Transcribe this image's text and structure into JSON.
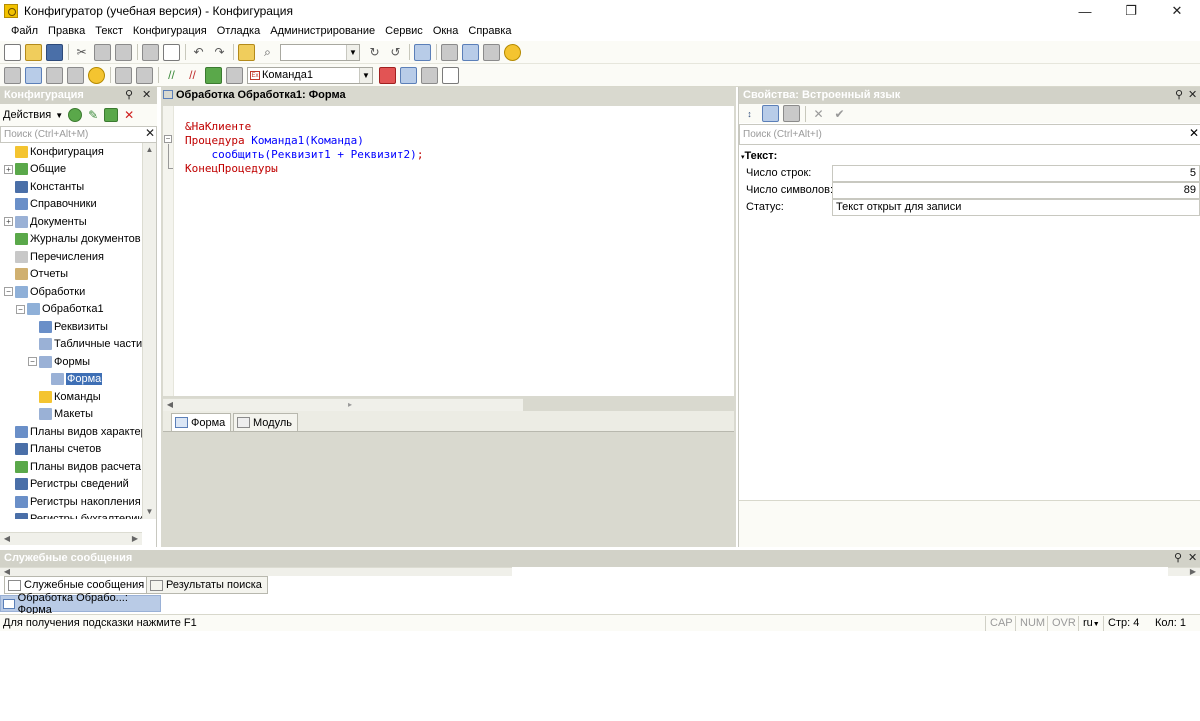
{
  "window": {
    "title": "Конфигуратор (учебная версия) - Конфигурация",
    "minimize": "—",
    "restore": "❐",
    "close": "✕"
  },
  "menu": [
    "Файл",
    "Правка",
    "Текст",
    "Конфигурация",
    "Отладка",
    "Администрирование",
    "Сервис",
    "Окна",
    "Справка"
  ],
  "toolbar": {
    "command_combo": "Команда1",
    "combo_mini_icon": "Ex"
  },
  "left_panel": {
    "title": "Конфигурация",
    "actions_label": "Действия",
    "search_placeholder": "Поиск (Ctrl+Alt+M)",
    "tree": [
      {
        "label": "Конфигурация",
        "level": 0,
        "expander": "",
        "icon": "#f4c430"
      },
      {
        "label": "Общие",
        "level": 0,
        "expander": "+",
        "icon": "#5aa84a"
      },
      {
        "label": "Константы",
        "level": 0,
        "expander": "",
        "icon": "#4a6fa8"
      },
      {
        "label": "Справочники",
        "level": 0,
        "expander": "",
        "icon": "#6a8fc8"
      },
      {
        "label": "Документы",
        "level": 0,
        "expander": "+",
        "icon": "#9ab1d6"
      },
      {
        "label": "Журналы документов",
        "level": 0,
        "expander": "",
        "icon": "#5aa84a"
      },
      {
        "label": "Перечисления",
        "level": 0,
        "expander": "",
        "icon": "#c8c8c8"
      },
      {
        "label": "Отчеты",
        "level": 0,
        "expander": "",
        "icon": "#d0b070"
      },
      {
        "label": "Обработки",
        "level": 0,
        "expander": "−",
        "icon": "#8fb0d8"
      },
      {
        "label": "Обработка1",
        "level": 1,
        "expander": "−",
        "icon": "#8fb0d8"
      },
      {
        "label": "Реквизиты",
        "level": 2,
        "expander": "",
        "icon": "#6a8fc8"
      },
      {
        "label": "Табличные части",
        "level": 2,
        "expander": "",
        "icon": "#9ab1d6"
      },
      {
        "label": "Формы",
        "level": 2,
        "expander": "−",
        "icon": "#9ab1d6"
      },
      {
        "label": "Форма",
        "level": 3,
        "expander": "",
        "icon": "#9ab1d6",
        "selected": true
      },
      {
        "label": "Команды",
        "level": 2,
        "expander": "",
        "icon": "#f4c430"
      },
      {
        "label": "Макеты",
        "level": 2,
        "expander": "",
        "icon": "#9ab1d6"
      },
      {
        "label": "Планы видов характер",
        "level": 0,
        "expander": "",
        "icon": "#6a8fc8"
      },
      {
        "label": "Планы счетов",
        "level": 0,
        "expander": "",
        "icon": "#4a6fa8"
      },
      {
        "label": "Планы видов расчета",
        "level": 0,
        "expander": "",
        "icon": "#5aa84a"
      },
      {
        "label": "Регистры сведений",
        "level": 0,
        "expander": "",
        "icon": "#4a6fa8"
      },
      {
        "label": "Регистры накопления",
        "level": 0,
        "expander": "",
        "icon": "#6a8fc8"
      },
      {
        "label": "Регистры бухгалтерии",
        "level": 0,
        "expander": "",
        "icon": "#4a6fa8"
      }
    ]
  },
  "editor": {
    "title": "Обработка Обработка1: Форма",
    "code": {
      "directive": "&НаКлиенте",
      "proc_kw": "Процедура ",
      "proc_name": "Команда1(Команда)",
      "call": "сообщить(Реквизит1 + Реквизит2)",
      "call_end": ";",
      "end_kw": "КонецПроцедуры"
    },
    "tabs": [
      "Форма",
      "Модуль"
    ]
  },
  "properties": {
    "title": "Свойства: Встроенный язык",
    "search_placeholder": "Поиск (Ctrl+Alt+I)",
    "group": "Текст:",
    "rows": [
      {
        "key": "Число строк:",
        "value": "5"
      },
      {
        "key": "Число символов:",
        "value": "89"
      },
      {
        "key": "Статус:",
        "value": "Текст открыт для записи"
      }
    ]
  },
  "messages": {
    "title": "Служебные сообщения",
    "tabs": [
      "Служебные сообщения",
      "Результаты поиска"
    ],
    "window_tab": "Обработка Обрабо...: Форма"
  },
  "status": {
    "hint": "Для получения подсказки нажмите F1",
    "cap": "CAP",
    "num": "NUM",
    "ovr": "OVR",
    "lang": "ru",
    "line": "Стр: 4",
    "col": "Кол: 1"
  }
}
